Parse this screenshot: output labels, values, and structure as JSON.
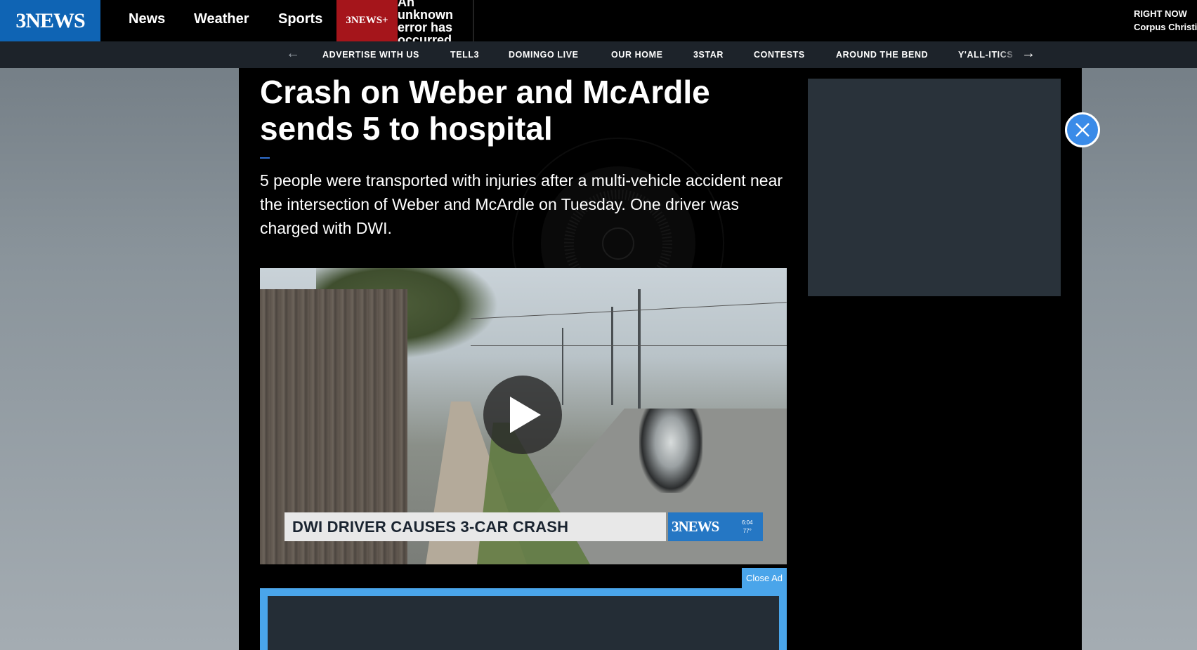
{
  "header": {
    "logo_text": "3NEWS",
    "nav": [
      "News",
      "Weather",
      "Sports"
    ],
    "plus_badge": "3NEWS+",
    "error_text": "An unknown error has occurred",
    "right_now_label": "RIGHT NOW",
    "right_now_location": "Corpus Christi"
  },
  "subnav": {
    "items": [
      "ADVERTISE WITH US",
      "TELL3",
      "DOMINGO LIVE",
      "OUR HOME",
      "3STAR",
      "CONTESTS",
      "AROUND THE BEND",
      "Y'ALL-ITICS"
    ],
    "prev_icon": "arrow-left-icon",
    "next_icon": "arrow-right-icon"
  },
  "article": {
    "headline": "Crash on Weber and McArdle sends 5 to hospital",
    "summary": "5 people were transported with injuries after a multi-vehicle accident near the intersection of Weber and McArdle on Tuesday. One driver was charged with DWI."
  },
  "video": {
    "lower_third": "DWI DRIVER CAUSES 3-CAR CRASH",
    "logo": "3NEWS",
    "time": "6:04",
    "temp": "77°"
  },
  "ad": {
    "close_label": "Close Ad"
  },
  "colors": {
    "brand_blue": "#0f64b4",
    "plus_red": "#a5151b",
    "ad_blue": "#4aa5ea"
  }
}
